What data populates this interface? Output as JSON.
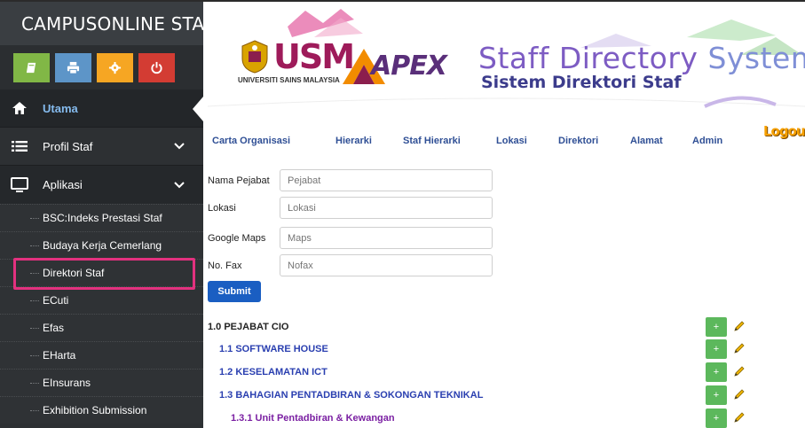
{
  "app": {
    "brand": "CAMPUSONLINE STAF"
  },
  "sidebar": {
    "shortcuts": [
      {
        "icon": "book-icon",
        "color": "#81b746"
      },
      {
        "icon": "print-icon",
        "color": "#5d95c8"
      },
      {
        "icon": "gear-icon",
        "color": "#f6a623"
      },
      {
        "icon": "power-icon",
        "color": "#d33c33"
      }
    ],
    "menu": {
      "utama": "Utama",
      "profil": "Profil Staf",
      "aplikasi": "Aplikasi"
    },
    "submenu": [
      "BSC:Indeks Prestasi Staf",
      "Budaya Kerja Cemerlang",
      "Direktori Staf",
      "ECuti",
      "Efas",
      "EHarta",
      "EInsurans",
      "Exhibition Submission"
    ],
    "highlight_color": "#e3317f"
  },
  "header": {
    "usm_letters": "USM",
    "usm_subtitle": "UNIVERSITI SAINS MALAYSIA",
    "apex": "APEX",
    "title_en_part1": "Staff Directory",
    "title_en_part2": "System",
    "title_ms": "Sistem Direktori Staf"
  },
  "nav": {
    "links": [
      "Carta Organisasi",
      "Hierarki",
      "Staf Hierarki",
      "Lokasi",
      "Direktori",
      "Alamat",
      "Admin"
    ],
    "logout": "Logout"
  },
  "form": {
    "fields": [
      {
        "label": "Nama Pejabat",
        "placeholder": "Pejabat"
      },
      {
        "label": "Lokasi",
        "placeholder": "Lokasi"
      },
      {
        "label": "Google Maps",
        "placeholder": "Maps"
      },
      {
        "label": "No. Fax",
        "placeholder": "Nofax"
      }
    ],
    "submit": "Submit"
  },
  "tree": [
    {
      "label": "1.0 PEJABAT CIO",
      "level": 0
    },
    {
      "label": "1.1 SOFTWARE HOUSE",
      "level": 1
    },
    {
      "label": "1.2 KESELAMATAN ICT",
      "level": 1
    },
    {
      "label": "1.3 BAHAGIAN PENTADBIRAN & SOKONGAN TEKNIKAL",
      "level": 1
    },
    {
      "label": "1.3.1 Unit Pentadbiran & Kewangan",
      "level": 2
    }
  ],
  "tree_actions": {
    "add_label": "+"
  }
}
